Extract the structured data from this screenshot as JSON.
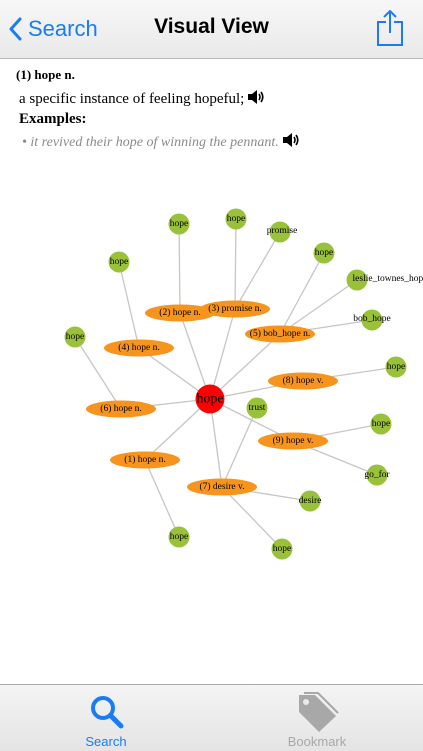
{
  "navbar": {
    "back_label": "Search",
    "title": "Visual View"
  },
  "definition": {
    "heading": "(1) hope n.",
    "text": "a specific instance of feeling hopeful;",
    "examples_label": "Examples:",
    "example": "• it revived their hope of winning the pennant."
  },
  "colors": {
    "accent": "#1a7cf5",
    "center": "#ff0000",
    "sense": "#f7941d",
    "word": "#99c13a",
    "edge": "#c6c6c6",
    "inactive": "#a8a8a8"
  },
  "graph": {
    "center": "hope",
    "senses": [
      {
        "id": "s1",
        "label": "(1) hope n.",
        "words": [
          "hope"
        ]
      },
      {
        "id": "s2",
        "label": "(2) hope n.",
        "words": [
          "hope"
        ]
      },
      {
        "id": "s3",
        "label": "(3) promise n.",
        "words": [
          "hope",
          "promise"
        ]
      },
      {
        "id": "s4",
        "label": "(4) hope n.",
        "words": [
          "hope"
        ]
      },
      {
        "id": "s5",
        "label": "(5) bob_hope n.",
        "words": [
          "hope",
          "leslie_townes_hope",
          "bob_hope"
        ]
      },
      {
        "id": "s6",
        "label": "(6) hope n.",
        "words": [
          "hope"
        ]
      },
      {
        "id": "s7",
        "label": "(7) desire v.",
        "words": [
          "trust",
          "desire",
          "hope"
        ]
      },
      {
        "id": "s8",
        "label": "(8) hope v.",
        "words": [
          "hope"
        ]
      },
      {
        "id": "s9",
        "label": "(9) hope v.",
        "words": [
          "hope",
          "go_for"
        ]
      }
    ]
  },
  "tabbar": {
    "search_label": "Search",
    "bookmark_label": "Bookmark"
  }
}
